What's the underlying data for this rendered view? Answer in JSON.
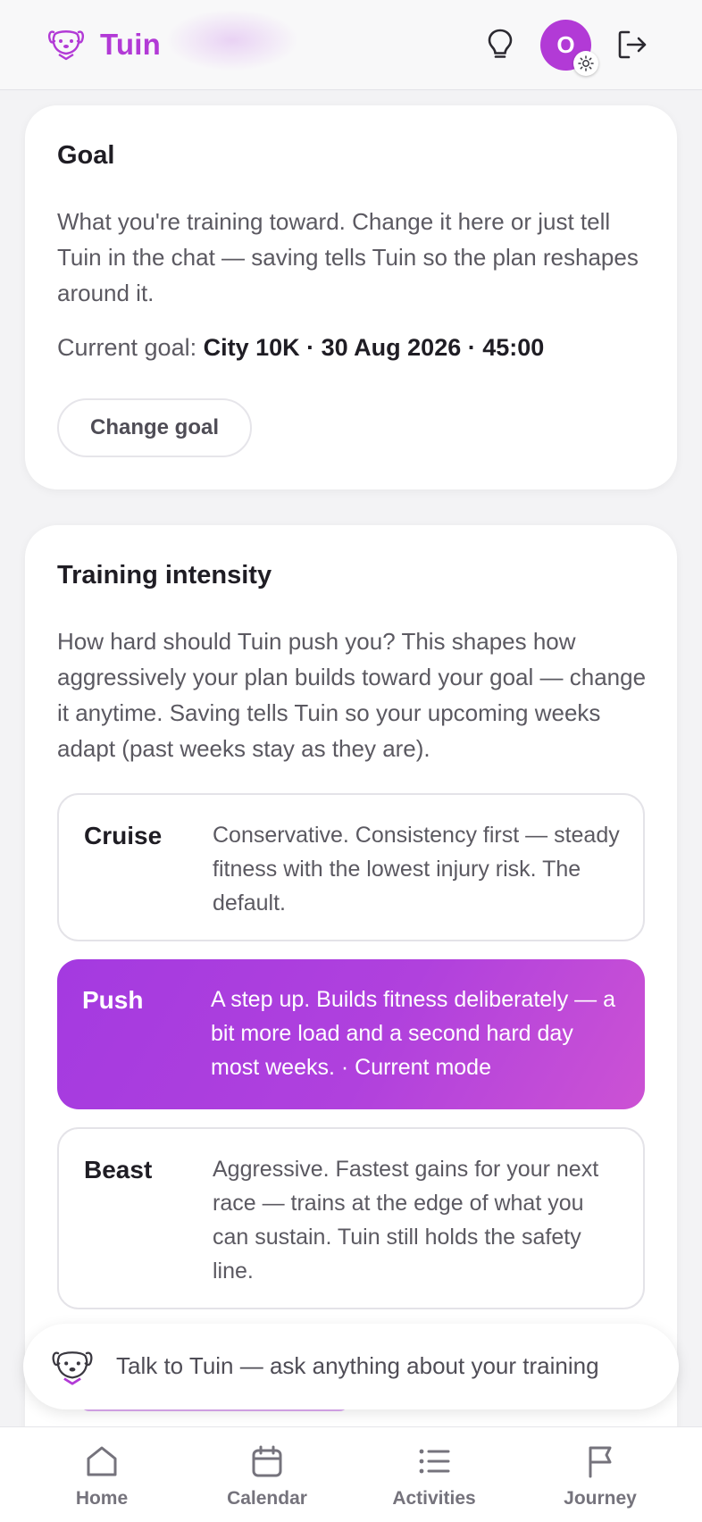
{
  "header": {
    "app_name": "Tuin",
    "avatar_initial": "O",
    "icons": [
      "dog-logo-icon",
      "lightbulb-icon",
      "sun-icon",
      "logout-icon"
    ]
  },
  "goal_card": {
    "title": "Goal",
    "description": "What you're training toward. Change it here or just tell Tuin in the chat — saving tells Tuin so the plan reshapes around it.",
    "current_goal_label": "Current goal:",
    "current_goal_value": "City 10K · 30 Aug 2026 · 45:00",
    "change_button": "Change goal"
  },
  "intensity_card": {
    "title": "Training intensity",
    "description": "How hard should Tuin push you? This shapes how aggressively your plan builds toward your goal — change it anytime. Saving tells Tuin so your upcoming weeks adapt (past weeks stay as they are).",
    "options": [
      {
        "name": "Cruise",
        "description": "Conservative. Consistency first — steady fitness with the lowest injury risk. The default.",
        "selected": false
      },
      {
        "name": "Push",
        "description": "A step up. Builds fitness deliberately — a bit more load and a second hard day most weeks. · Current mode",
        "selected": true
      },
      {
        "name": "Beast",
        "description": "Aggressive. Fastest gains for your next race — trains at the edge of what you can sustain. Tuin still holds the safety line.",
        "selected": false
      }
    ]
  },
  "chat": {
    "prompt": "Talk to Tuin — ask anything about your training"
  },
  "nav": {
    "items": [
      {
        "label": "Home",
        "icon": "home-icon"
      },
      {
        "label": "Calendar",
        "icon": "calendar-icon"
      },
      {
        "label": "Activities",
        "icon": "list-icon"
      },
      {
        "label": "Journey",
        "icon": "flag-icon"
      }
    ]
  },
  "colors": {
    "brand": "#b23ad6",
    "selected_gradient_start": "#a43ae0",
    "selected_gradient_end": "#cc52d4",
    "text_primary": "#1f1d24",
    "text_secondary": "#5b5961"
  }
}
